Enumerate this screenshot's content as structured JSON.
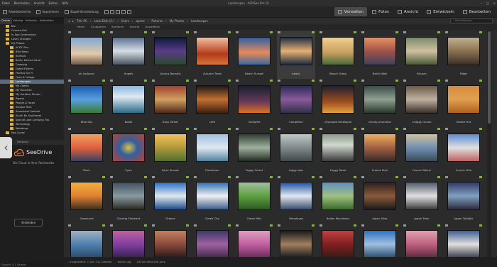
{
  "window": {
    "title": "Landscapes - ACDSee Pro 10",
    "menus": [
      "Datei",
      "Bearbeiten",
      "Ansicht",
      "Extras",
      "Hilfe"
    ]
  },
  "toolbar": {
    "items": [
      "Arbeitsbereiche",
      "Importieren",
      "Stapel-Verarbeitung"
    ],
    "modes": [
      "Verwalten",
      "Fotos",
      "Ansicht",
      "Entwickeln",
      "Bearbeiten"
    ],
    "active_mode": "Verwalten"
  },
  "sidebar": {
    "tabs": [
      "Ordner",
      "Katalog",
      "Kalender",
      "Aktivitäten"
    ],
    "tree": [
      {
        "label": "Bio"
      },
      {
        "label": "Camera Roll"
      },
      {
        "label": "In App Screenshots"
      },
      {
        "label": "Lovey Changes"
      },
      {
        "label": "My Photos"
      },
      {
        "label": "ACDC Pics"
      },
      {
        "label": "Bills News"
      },
      {
        "label": "Animals"
      },
      {
        "label": "Berlin Kitchen Reno"
      },
      {
        "label": "Camping"
      },
      {
        "label": "Dated Folders"
      },
      {
        "label": "Fantasy Sci Fi"
      },
      {
        "label": "Food & Foliage"
      },
      {
        "label": "Landscapes",
        "selected": true
      },
      {
        "label": "My Clients"
      },
      {
        "label": "My Favorites"
      },
      {
        "label": "My Vacation Photos"
      },
      {
        "label": "Papers"
      },
      {
        "label": "People & Faces"
      },
      {
        "label": "Sample Files"
      },
      {
        "label": "Snowpulse Festival"
      },
      {
        "label": "South By Southwest"
      },
      {
        "label": "Special Lake Camping Trip"
      },
      {
        "label": "Technology"
      },
      {
        "label": "Weddings"
      },
      {
        "label": "Non Lovey"
      }
    ]
  },
  "seedrive": {
    "header": "SeeDrive",
    "name": "SeeDrive",
    "tagline": "Die Cloud in Ihrer Reichweite",
    "connect": "Verbinden"
  },
  "pathbar": {
    "crumbs": [
      "This PC",
      "Local Disk (C:)",
      "Users",
      "apirce",
      "Pictures",
      "My Photos",
      "Landscapes"
    ],
    "search_placeholder": "Schnellsuche"
  },
  "filterbar": {
    "items": [
      "Filtern",
      "Gruppieren",
      "Sortieren",
      "Ansicht",
      "Auswählen"
    ]
  },
  "grid": {
    "items": [
      {
        "name": "air balloons",
        "bg": "linear-gradient(#7fa8d6,#e4c9a8 60%,#6f5a4a)"
      },
      {
        "name": "Angels",
        "bg": "linear-gradient(#5a7090,#d8dde4 50%,#47535e)"
      },
      {
        "name": "Aurora Borealis",
        "bg": "linear-gradient(#0c1a3a,#5a3c8a 50%,#2a4a2a)"
      },
      {
        "name": "Autumn Trees",
        "bg": "linear-gradient(#f2c0a0,#b33a1a 60%,#d5763a)"
      },
      {
        "name": "Beach Sunset",
        "bg": "linear-gradient(#2b5fa8,#e88a5a 55%,#3a6aa0)"
      },
      {
        "name": "beach",
        "bg": "linear-gradient(#20304a,#e8b070 50%,#1a2a40)",
        "selected": true
      },
      {
        "name": "Beach Grass",
        "bg": "linear-gradient(#f0d090,#c8a060 55%,#4a6a3a)"
      },
      {
        "name": "Berlin Wall",
        "bg": "linear-gradient(#e89060,#a0524a 50%,#40405a)"
      },
      {
        "name": "Bhutan",
        "bg": "linear-gradient(#7a8a6a,#cfc0a0 50%,#4a5a3a)"
      },
      {
        "name": "Bikes",
        "bg": "linear-gradient(#c0b090,#8a7050 50%,#3a3028)"
      },
      {
        "name": "Blue Sky",
        "bg": "linear-gradient(#1a5ab0,#58a0e0 50%,#3a7a30)"
      },
      {
        "name": "Boats",
        "bg": "linear-gradient(#88b8e0,#e0e8f0 40%,#2a6a8a)"
      },
      {
        "name": "Busy Street",
        "bg": "linear-gradient(#a04030,#d0a060 50%,#502818)"
      },
      {
        "name": "cafe",
        "bg": "linear-gradient(#201818,#c07030 50%,#402010)"
      },
      {
        "name": "Campfire",
        "bg": "linear-gradient(#182030,#6a3a5a 60%,#e07020)"
      },
      {
        "name": "Campfire2",
        "bg": "linear-gradient(#2a2a5a,#8a5a9a 50%,#303048)"
      },
      {
        "name": "cityscape-timelapse",
        "bg": "linear-gradient(#202030,#a05020 60%,#e0a040)"
      },
      {
        "name": "cloudy-mountain",
        "bg": "linear-gradient(#3a4a4a,#90a090 50%,#2a3a2a)"
      },
      {
        "name": "Craggy Ocean",
        "bg": "linear-gradient(#6a5a4a,#c0b0a0 50%,#3a3028)"
      },
      {
        "name": "Desert Hut",
        "bg": "linear-gradient(#d88a40,#e0a050 50%,#b06020)"
      },
      {
        "name": "Dock",
        "bg": "linear-gradient(#f0a060,#e06040 50%,#3a4060)"
      },
      {
        "name": "Eyes",
        "bg": "radial-gradient(#e0c040,#3060a0 40%,#c04030)"
      },
      {
        "name": "Farm Sunset",
        "bg": "linear-gradient(#f0c060,#c0a040 40%,#507030)"
      },
      {
        "name": "Fisherman",
        "bg": "linear-gradient(#a0c0e0,#e0e8f0 50%,#5080a0)"
      },
      {
        "name": "Foggy Forest",
        "bg": "linear-gradient(#304030,#a0b0a0 50%,#202a20)"
      },
      {
        "name": "foggy lake",
        "bg": "linear-gradient(#c0c8c8,#808a8a 50%,#404848)"
      },
      {
        "name": "Foggy Road",
        "bg": "linear-gradient(#8a9a8a,#d0d8d0 40%,#3a3a3a)"
      },
      {
        "name": "France Eiell",
        "bg": "linear-gradient(#f0b060,#a06040 50%,#3a2a2a)"
      },
      {
        "name": "France Wheel",
        "bg": "linear-gradient(#d0c0a0,#7090b0 50%,#3a4a5a)"
      },
      {
        "name": "French Villa",
        "bg": "linear-gradient(#5a8ad0,#e0e0e0 50%,#c06060)"
      },
      {
        "name": "Grassland",
        "bg": "linear-gradient(#f0b040,#e08030 50%,#3a3020)"
      },
      {
        "name": "Grazing Elephant",
        "bg": "linear-gradient(#405060,#8a9aa0 50%,#2a2a20)"
      },
      {
        "name": "Greece",
        "bg": "linear-gradient(#2a70c0,#e0e8f0 50%,#1a4a8a)"
      },
      {
        "name": "Greek City",
        "bg": "linear-gradient(#3070b0,#f0f0f0 50%,#3a5a8a)"
      },
      {
        "name": "Green Hills",
        "bg": "linear-gradient(#a0c0a0,#60a040 50%,#2a5a20)"
      },
      {
        "name": "Himalayas",
        "bg": "linear-gradient(#2050a0,#e0e8f0 50%,#3a4a6a)"
      },
      {
        "name": "Italian Mountains",
        "bg": "linear-gradient(#6090c0,#a0c080 50%,#3a6a2a)"
      },
      {
        "name": "Japan Alley",
        "bg": "linear-gradient(#2a2020,#8a5a3a 50%,#1a1a1a)"
      },
      {
        "name": "Japan Train",
        "bg": "linear-gradient(#505a6a,#e0e0e0 50%,#3a3a3a)"
      },
      {
        "name": "Japan Twilight",
        "bg": "linear-gradient(#303a6a,#80a0c0 50%,#2a2a3a)"
      },
      {
        "name": "",
        "bg": "linear-gradient(#a0b0c0,#5080b0 50%,#2a4a6a)"
      },
      {
        "name": "",
        "bg": "linear-gradient(#c060a0,#8040a0 50%,#3a2050)"
      },
      {
        "name": "",
        "bg": "linear-gradient(#c08060,#8a4a3a 50%,#2a1a1a)"
      },
      {
        "name": "",
        "bg": "linear-gradient(#3a3a6a,#a060a0 50%,#402a4a)"
      },
      {
        "name": "",
        "bg": "linear-gradient(#e0a0c0,#c060a0 50%,#6a2a5a)"
      },
      {
        "name": "",
        "bg": "linear-gradient(#1a1a1a,#a08060 50%,#1a1a1a)"
      },
      {
        "name": "",
        "bg": "linear-gradient(#c04040,#802020 50%,#3a1a1a)"
      },
      {
        "name": "",
        "bg": "linear-gradient(#3070c0,#a0c0e0 50%,#2a4a6a)"
      },
      {
        "name": "",
        "bg": "linear-gradient(#e0a0b0,#c06080 50%,#5a2a3a)"
      },
      {
        "name": "",
        "bg": "linear-gradient(#406090,#e0e0e0 50%,#3a3a4a)"
      }
    ]
  },
  "statusbar": {
    "text": [
      "Ausgewählt: 1 von 111 Dateien",
      "beach.jpg",
      "1920x1080x24b jpeg"
    ]
  },
  "leftstatus": {
    "text": "Gesamt 111 Dateien"
  }
}
